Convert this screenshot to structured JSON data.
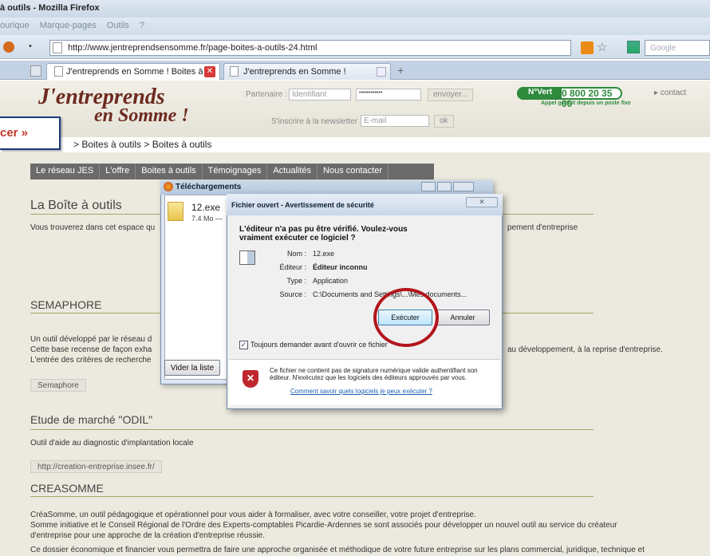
{
  "window": {
    "title": "à outils - Mozilla Firefox"
  },
  "menu": [
    "ourique",
    "Marque-pages",
    "Outils",
    "?"
  ],
  "address": {
    "url": "http://www.jentreprendsensomme.fr/page-boites-a-outils-24.html"
  },
  "search": {
    "placeholder": "Google"
  },
  "tabs": [
    {
      "label": "J'entreprends en Somme ! Boites à ..."
    },
    {
      "label": "J'entreprends en Somme !"
    }
  ],
  "site": {
    "logo_line1": "J'entreprends",
    "logo_line2": "en Somme !",
    "partner_label": "Partenaire :",
    "id_placeholder": "Identifiant",
    "password_mask": "••••••••••••",
    "send_label": "envoyer...",
    "newsletter_label": "S'inscrire à la newsletter :",
    "email_placeholder": "E-mail",
    "ok_label": "ok",
    "green_number_badge": "N°Vert",
    "phone": "0 800 20 35 00",
    "phone_sub": "Appel gratuit depuis un poste fixe",
    "contact": "contact",
    "breadcrumb": "> Boites à outils > Boites à outils",
    "callout": "cer »",
    "nav": [
      "Le réseau JES",
      "L'offre",
      "Boites à outils",
      "Témoignages",
      "Actualités",
      "Nous contacter"
    ],
    "page_title": "La Boîte à outils",
    "intro_left": "Vous trouverez dans cet espace qu",
    "intro_right": "pement d'entreprise",
    "sections": {
      "semaphore_title": "SEMAPHORE",
      "semaphore_line1": "Un outil développé par le réseau d",
      "semaphore_line2": "Cette base recense de façon exha",
      "semaphore_line2_right": "au développement, à la reprise d'entreprise.",
      "semaphore_line3": "L'entrée des critères de recherche",
      "semaphore_btn": "Semaphore",
      "odil_title": "Etude de marché \"ODIL\"",
      "odil_text": "Outil d'aide au diagnostic d'implantation locale",
      "odil_btn": "http://creation-entreprise.insee.fr/",
      "crea_title": "CREASOMME",
      "crea_line1": "CréaSomme, un outil pédagogique et opérationnel pour vous aider à formaliser, avec votre conseiller, votre projet d'entreprise.",
      "crea_line2": "Somme initiative et le Conseil Régional de l'Ordre des Experts-comptables Picardie-Ardennes se sont associés pour développer un nouvel outil au service du créateur",
      "crea_line3": "d'entreprise pour une approche de la création d'entreprise réussie.",
      "crea_line4": "Ce dossier économique et financier vous permettra de faire une approche organisée et méthodique de votre future entreprise sur les plans commercial, juridique, technique et"
    }
  },
  "downloads": {
    "title": "Téléchargements",
    "file": "12.exe",
    "size": "7.4 Mo —",
    "clear_label": "Vider la liste"
  },
  "dialog": {
    "title": "Fichier ouvert - Avertissement de sécurité",
    "question": "L'éditeur n'a pas pu être vérifié. Voulez-vous vraiment exécuter ce logiciel ?",
    "name_label": "Nom :",
    "name_value": "12.exe",
    "publisher_label": "Éditeur :",
    "publisher_value": "Éditeur inconnu",
    "type_label": "Type :",
    "type_value": "Application",
    "source_label": "Source :",
    "source_value": "C:\\Documents and Settings\\...\\Mes documents...",
    "run_label": "Exécuter",
    "cancel_label": "Annuler",
    "always_ask": "Toujours demander avant d'ouvrir ce fichier",
    "warning": "Ce fichier ne contient pas de signature numérique valide authentifiant son éditeur. N'exécutez que les logiciels des éditeurs approuvés par vous.",
    "link": "Comment savoir quels logiciels je peux exécuter ?"
  }
}
